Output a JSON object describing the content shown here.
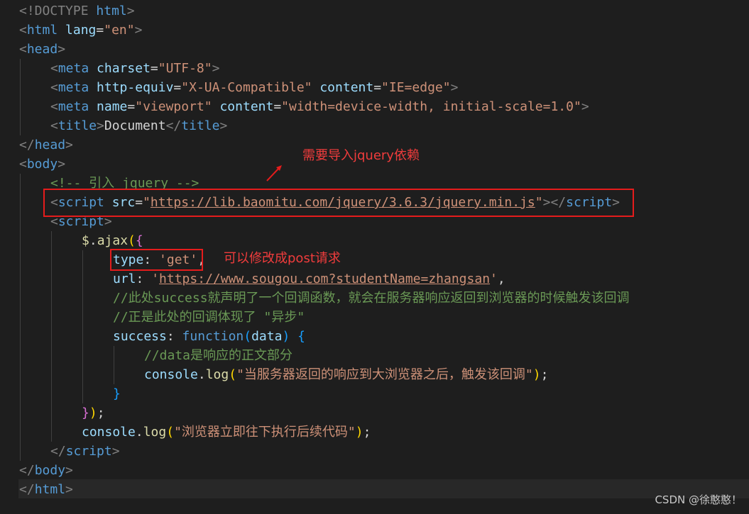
{
  "code": {
    "doctype": "<!DOCTYPE html>",
    "html_tag": "html",
    "lang_attr": "lang",
    "lang_value": "\"en\"",
    "head_tag": "head",
    "meta_tag": "meta",
    "charset_attr": "charset",
    "charset_value": "\"UTF-8\"",
    "http_equiv_attr": "http-equiv",
    "http_equiv_value": "\"X-UA-Compatible\"",
    "content_attr": "content",
    "ie_value": "\"IE=edge\"",
    "name_attr": "name",
    "viewport_value": "\"viewport\"",
    "viewport_content_value": "\"width=device-width, initial-scale=1.0\"",
    "title_tag": "title",
    "title_text": "Document",
    "body_tag": "body",
    "comment_jquery": "<!-- 引入 jquery -->",
    "script_tag": "script",
    "src_attr": "src",
    "src_value": "https://lib.baomitu.com/jquery/3.6.3/jquery.min.js",
    "ajax_obj": "$",
    "ajax_method": "ajax",
    "type_key": "type",
    "type_value": "'get'",
    "url_key": "url",
    "url_value": "https://www.sougou.com?studentName=zhangsan",
    "comment_success": "//此处success就声明了一个回调函数，就会在服务器响应返回到浏览器的时候触发该回调",
    "comment_async": "//正是此处的回调体现了 \"异步\"",
    "success_key": "success",
    "function_kw": "function",
    "data_param": "data",
    "comment_data": "//data是响应的正文部分",
    "console_obj": "console",
    "log_fn": "log",
    "log_msg_1": "\"当服务器返回的响应到大浏览器之后，触发该回调\"",
    "log_msg_2": "\"浏览器立即往下执行后续代码\""
  },
  "annotations": {
    "jquery_note": "需要导入jquery依赖",
    "post_note": "可以修改成post请求"
  },
  "watermark": "CSDN @徐憨憨！",
  "colors": {
    "background": "#1e1e1e",
    "tag": "#569cd6",
    "attribute": "#9cdcfe",
    "string": "#ce9178",
    "comment": "#6a9955",
    "function": "#dcdcaa",
    "annotation": "#e51c1c"
  }
}
